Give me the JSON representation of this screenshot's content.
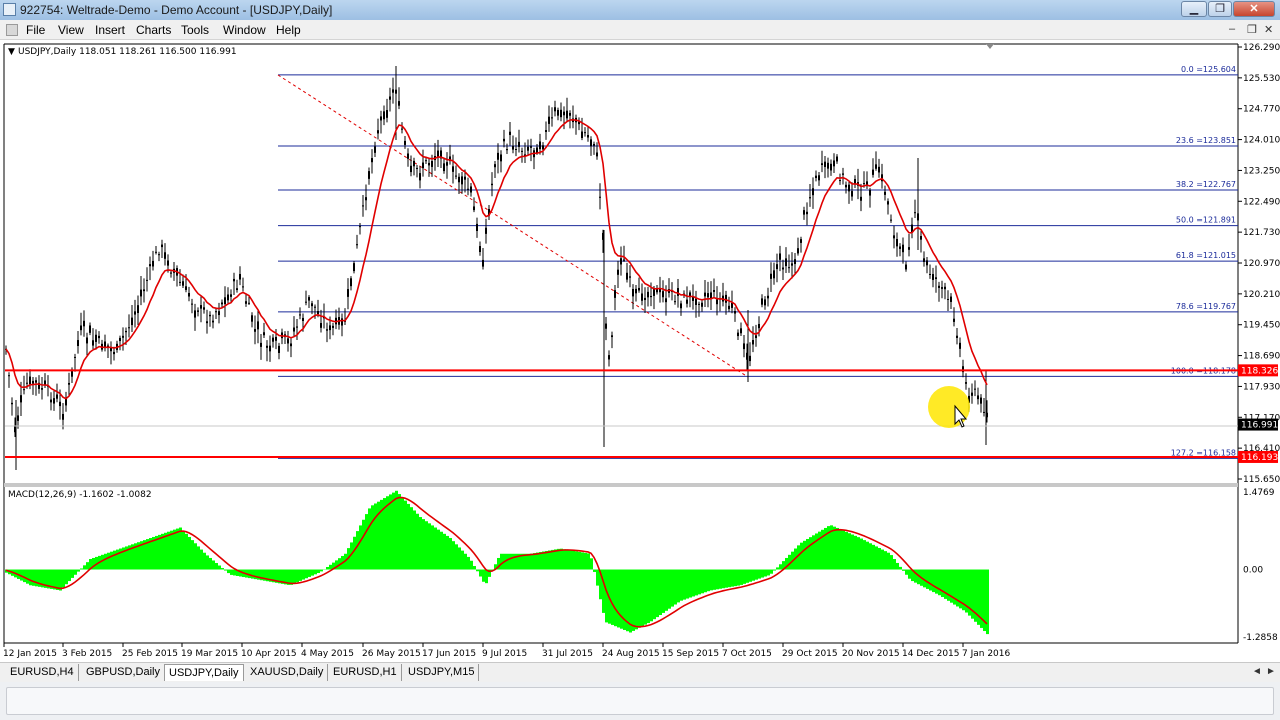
{
  "window": {
    "title": "922754: Weltrade-Demo - Demo Account - [USDJPY,Daily]"
  },
  "window_controls": {
    "minimize": "▁",
    "restore": "❐",
    "close": "✕"
  },
  "menu": {
    "items": [
      "File",
      "View",
      "Insert",
      "Charts",
      "Tools",
      "Window",
      "Help"
    ]
  },
  "mdi_controls": {
    "minimize": "–",
    "restore": "❐",
    "close": "✕"
  },
  "chart": {
    "info": "USDJPY,Daily  118.051 118.261 116.500 116.991",
    "price_labels": [
      "126.290",
      "125.530",
      "124.770",
      "124.010",
      "123.250",
      "122.490",
      "121.730",
      "120.970",
      "120.210",
      "119.450",
      "118.690",
      "117.930",
      "117.170",
      "116.410",
      "115.650"
    ],
    "current_price": "116.991",
    "fib_labels": [
      {
        "text": "0.0 =125.604",
        "price": 125.604
      },
      {
        "text": "23.6 =123.851",
        "price": 123.851
      },
      {
        "text": "38.2 =122.767",
        "price": 122.767
      },
      {
        "text": "50.0 =121.891",
        "price": 121.891
      },
      {
        "text": "61.8 =121.015",
        "price": 121.015
      },
      {
        "text": "78.6 =119.767",
        "price": 119.767
      },
      {
        "text": "100.0 =118.178",
        "price": 118.178
      },
      {
        "text": "127.2 =116.158",
        "price": 116.158
      }
    ],
    "hline_labels": [
      {
        "text": "118.326",
        "price": 118.326
      },
      {
        "text": "116.193",
        "price": 116.193
      }
    ],
    "colors": {
      "fib": "#1b2b9a",
      "ma": "#e00000",
      "hline": "#ff0000",
      "macd_hist": "#00ff00",
      "macd_signal": "#e00000",
      "candles": "#000000"
    }
  },
  "macd": {
    "label": "MACD(12,26,9) -1.1602 -1.0082",
    "scale_labels": [
      "1.4769",
      "0.00",
      "-1.2858"
    ]
  },
  "date_labels": [
    "12 Jan 2015",
    "3 Feb 2015",
    "25 Feb 2015",
    "19 Mar 2015",
    "10 Apr 2015",
    "4 May 2015",
    "26 May 2015",
    "17 Jun 2015",
    "9 Jul 2015",
    "31 Jul 2015",
    "24 Aug 2015",
    "15 Sep 2015",
    "7 Oct 2015",
    "29 Oct 2015",
    "20 Nov 2015",
    "14 Dec 2015",
    "7 Jan 2016"
  ],
  "chart_tabs": [
    "EURUSD,H4",
    "GBPUSD,Daily",
    "USDJPY,Daily",
    "XAUUSD,Daily",
    "EURUSD,H1",
    "USDJPY,M15"
  ],
  "active_tab": "USDJPY,Daily",
  "tab_arrows": {
    "left": "◄",
    "right": "►"
  }
}
